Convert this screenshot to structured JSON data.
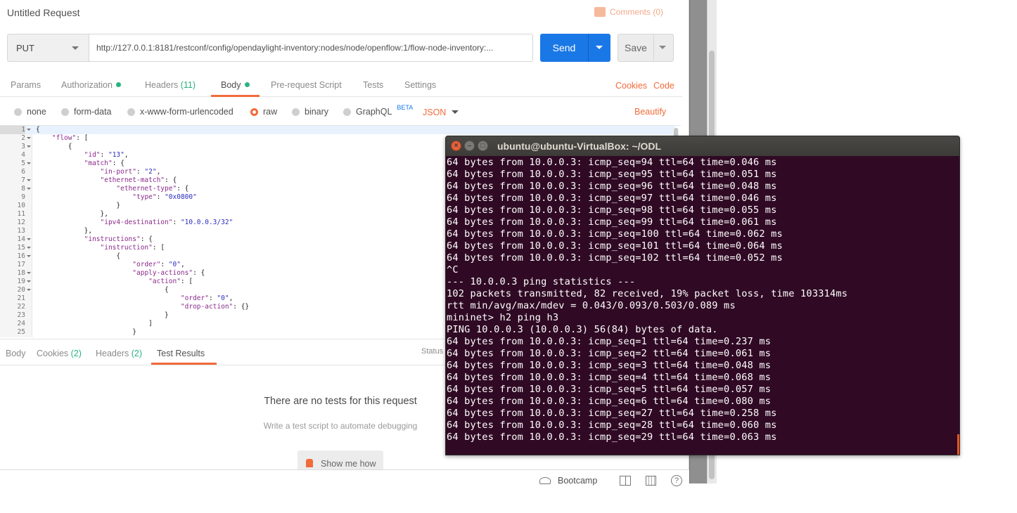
{
  "postman": {
    "title": "Untitled Request",
    "comments_label": "Comments (0)",
    "method": "PUT",
    "url": "http://127.0.0.1:8181/restconf/config/opendaylight-inventory:nodes/node/openflow:1/flow-node-inventory:...",
    "send_label": "Send",
    "save_label": "Save",
    "request_tabs": {
      "params": "Params",
      "authorization": "Authorization",
      "headers": "Headers",
      "headers_count": "(11)",
      "body": "Body",
      "prerequest": "Pre-request Script",
      "tests": "Tests",
      "settings": "Settings"
    },
    "cookies_link": "Cookies",
    "code_link": "Code",
    "body_modes": {
      "none": "none",
      "form_data": "form-data",
      "urlencoded": "x-www-form-urlencoded",
      "raw": "raw",
      "binary": "binary",
      "graphql": "GraphQL",
      "beta": "BETA",
      "selected": "raw"
    },
    "content_type": "JSON",
    "beautify_label": "Beautify",
    "accent_color": "#f26b3a",
    "send_color": "#1a78e6",
    "editor_lines": [
      {
        "no": "1",
        "fold": true,
        "tokens": [
          {
            "t": "{",
            "c": "p"
          }
        ]
      },
      {
        "no": "2",
        "fold": true,
        "tokens": [
          {
            "t": "    ",
            "c": "p"
          },
          {
            "t": "\"flow\"",
            "c": "k"
          },
          {
            "t": ": [",
            "c": "p"
          }
        ]
      },
      {
        "no": "3",
        "fold": true,
        "tokens": [
          {
            "t": "        {",
            "c": "p"
          }
        ]
      },
      {
        "no": "4",
        "fold": false,
        "tokens": [
          {
            "t": "            ",
            "c": "p"
          },
          {
            "t": "\"id\"",
            "c": "k"
          },
          {
            "t": ": ",
            "c": "p"
          },
          {
            "t": "\"13\"",
            "c": "s"
          },
          {
            "t": ",",
            "c": "p"
          }
        ]
      },
      {
        "no": "5",
        "fold": true,
        "tokens": [
          {
            "t": "            ",
            "c": "p"
          },
          {
            "t": "\"match\"",
            "c": "k"
          },
          {
            "t": ": {",
            "c": "p"
          }
        ]
      },
      {
        "no": "6",
        "fold": false,
        "tokens": [
          {
            "t": "                ",
            "c": "p"
          },
          {
            "t": "\"in-port\"",
            "c": "k"
          },
          {
            "t": ": ",
            "c": "p"
          },
          {
            "t": "\"2\"",
            "c": "s"
          },
          {
            "t": ",",
            "c": "p"
          }
        ]
      },
      {
        "no": "7",
        "fold": true,
        "tokens": [
          {
            "t": "                ",
            "c": "p"
          },
          {
            "t": "\"ethernet-match\"",
            "c": "k"
          },
          {
            "t": ": {",
            "c": "p"
          }
        ]
      },
      {
        "no": "8",
        "fold": true,
        "tokens": [
          {
            "t": "                    ",
            "c": "p"
          },
          {
            "t": "\"ethernet-type\"",
            "c": "k"
          },
          {
            "t": ": {",
            "c": "p"
          }
        ]
      },
      {
        "no": "9",
        "fold": false,
        "tokens": [
          {
            "t": "                        ",
            "c": "p"
          },
          {
            "t": "\"type\"",
            "c": "k"
          },
          {
            "t": ": ",
            "c": "p"
          },
          {
            "t": "\"0x0800\"",
            "c": "s"
          }
        ]
      },
      {
        "no": "10",
        "fold": false,
        "tokens": [
          {
            "t": "                    }",
            "c": "p"
          }
        ]
      },
      {
        "no": "11",
        "fold": false,
        "tokens": [
          {
            "t": "                },",
            "c": "p"
          }
        ]
      },
      {
        "no": "12",
        "fold": false,
        "tokens": [
          {
            "t": "                ",
            "c": "p"
          },
          {
            "t": "\"ipv4-destination\"",
            "c": "k"
          },
          {
            "t": ": ",
            "c": "p"
          },
          {
            "t": "\"10.0.0.3/32\"",
            "c": "s"
          }
        ]
      },
      {
        "no": "13",
        "fold": false,
        "tokens": [
          {
            "t": "            },",
            "c": "p"
          }
        ]
      },
      {
        "no": "14",
        "fold": true,
        "tokens": [
          {
            "t": "            ",
            "c": "p"
          },
          {
            "t": "\"instructions\"",
            "c": "k"
          },
          {
            "t": ": {",
            "c": "p"
          }
        ]
      },
      {
        "no": "15",
        "fold": true,
        "tokens": [
          {
            "t": "                ",
            "c": "p"
          },
          {
            "t": "\"instruction\"",
            "c": "k"
          },
          {
            "t": ": [",
            "c": "p"
          }
        ]
      },
      {
        "no": "16",
        "fold": true,
        "tokens": [
          {
            "t": "                    {",
            "c": "p"
          }
        ]
      },
      {
        "no": "17",
        "fold": false,
        "tokens": [
          {
            "t": "                        ",
            "c": "p"
          },
          {
            "t": "\"order\"",
            "c": "k"
          },
          {
            "t": ": ",
            "c": "p"
          },
          {
            "t": "\"0\"",
            "c": "s"
          },
          {
            "t": ",",
            "c": "p"
          }
        ]
      },
      {
        "no": "18",
        "fold": true,
        "tokens": [
          {
            "t": "                        ",
            "c": "p"
          },
          {
            "t": "\"apply-actions\"",
            "c": "k"
          },
          {
            "t": ": {",
            "c": "p"
          }
        ]
      },
      {
        "no": "19",
        "fold": true,
        "tokens": [
          {
            "t": "                            ",
            "c": "p"
          },
          {
            "t": "\"action\"",
            "c": "k"
          },
          {
            "t": ": [",
            "c": "p"
          }
        ]
      },
      {
        "no": "20",
        "fold": true,
        "tokens": [
          {
            "t": "                                {",
            "c": "p"
          }
        ]
      },
      {
        "no": "21",
        "fold": false,
        "tokens": [
          {
            "t": "                                    ",
            "c": "p"
          },
          {
            "t": "\"order\"",
            "c": "k"
          },
          {
            "t": ": ",
            "c": "p"
          },
          {
            "t": "\"0\"",
            "c": "s"
          },
          {
            "t": ",",
            "c": "p"
          }
        ]
      },
      {
        "no": "22",
        "fold": false,
        "tokens": [
          {
            "t": "                                    ",
            "c": "p"
          },
          {
            "t": "\"drop-action\"",
            "c": "k"
          },
          {
            "t": ": {}",
            "c": "p"
          }
        ]
      },
      {
        "no": "23",
        "fold": false,
        "tokens": [
          {
            "t": "                                }",
            "c": "p"
          }
        ]
      },
      {
        "no": "24",
        "fold": false,
        "tokens": [
          {
            "t": "                            ]",
            "c": "p"
          }
        ]
      },
      {
        "no": "25",
        "fold": false,
        "tokens": [
          {
            "t": "                        }",
            "c": "p"
          }
        ]
      }
    ],
    "response_tabs": {
      "body": "Body",
      "cookies": "Cookies",
      "cookies_count": "(2)",
      "headers": "Headers",
      "headers_count": "(2)",
      "test_results": "Test Results"
    },
    "status_label": "Status",
    "empty_title": "There are no tests for this request",
    "empty_subtitle": "Write a test script to automate debugging",
    "show_me_label": "Show me how",
    "footer_bootcamp": "Bootcamp"
  },
  "terminal": {
    "title": "ubuntu@ubuntu-VirtualBox: ~/ODL",
    "background_color": "#300a24",
    "lines": [
      "64 bytes from 10.0.0.3: icmp_seq=94 ttl=64 time=0.046 ms",
      "64 bytes from 10.0.0.3: icmp_seq=95 ttl=64 time=0.051 ms",
      "64 bytes from 10.0.0.3: icmp_seq=96 ttl=64 time=0.048 ms",
      "64 bytes from 10.0.0.3: icmp_seq=97 ttl=64 time=0.046 ms",
      "64 bytes from 10.0.0.3: icmp_seq=98 ttl=64 time=0.055 ms",
      "64 bytes from 10.0.0.3: icmp_seq=99 ttl=64 time=0.061 ms",
      "64 bytes from 10.0.0.3: icmp_seq=100 ttl=64 time=0.062 ms",
      "64 bytes from 10.0.0.3: icmp_seq=101 ttl=64 time=0.064 ms",
      "64 bytes from 10.0.0.3: icmp_seq=102 ttl=64 time=0.052 ms",
      "^C",
      "--- 10.0.0.3 ping statistics ---",
      "102 packets transmitted, 82 received, 19% packet loss, time 103314ms",
      "rtt min/avg/max/mdev = 0.043/0.093/0.503/0.089 ms",
      "mininet> h2 ping h3",
      "PING 10.0.0.3 (10.0.0.3) 56(84) bytes of data.",
      "64 bytes from 10.0.0.3: icmp_seq=1 ttl=64 time=0.237 ms",
      "64 bytes from 10.0.0.3: icmp_seq=2 ttl=64 time=0.061 ms",
      "64 bytes from 10.0.0.3: icmp_seq=3 ttl=64 time=0.048 ms",
      "64 bytes from 10.0.0.3: icmp_seq=4 ttl=64 time=0.068 ms",
      "64 bytes from 10.0.0.3: icmp_seq=5 ttl=64 time=0.057 ms",
      "64 bytes from 10.0.0.3: icmp_seq=6 ttl=64 time=0.080 ms",
      "64 bytes from 10.0.0.3: icmp_seq=27 ttl=64 time=0.258 ms",
      "64 bytes from 10.0.0.3: icmp_seq=28 ttl=64 time=0.060 ms",
      "64 bytes from 10.0.0.3: icmp_seq=29 ttl=64 time=0.063 ms"
    ]
  }
}
